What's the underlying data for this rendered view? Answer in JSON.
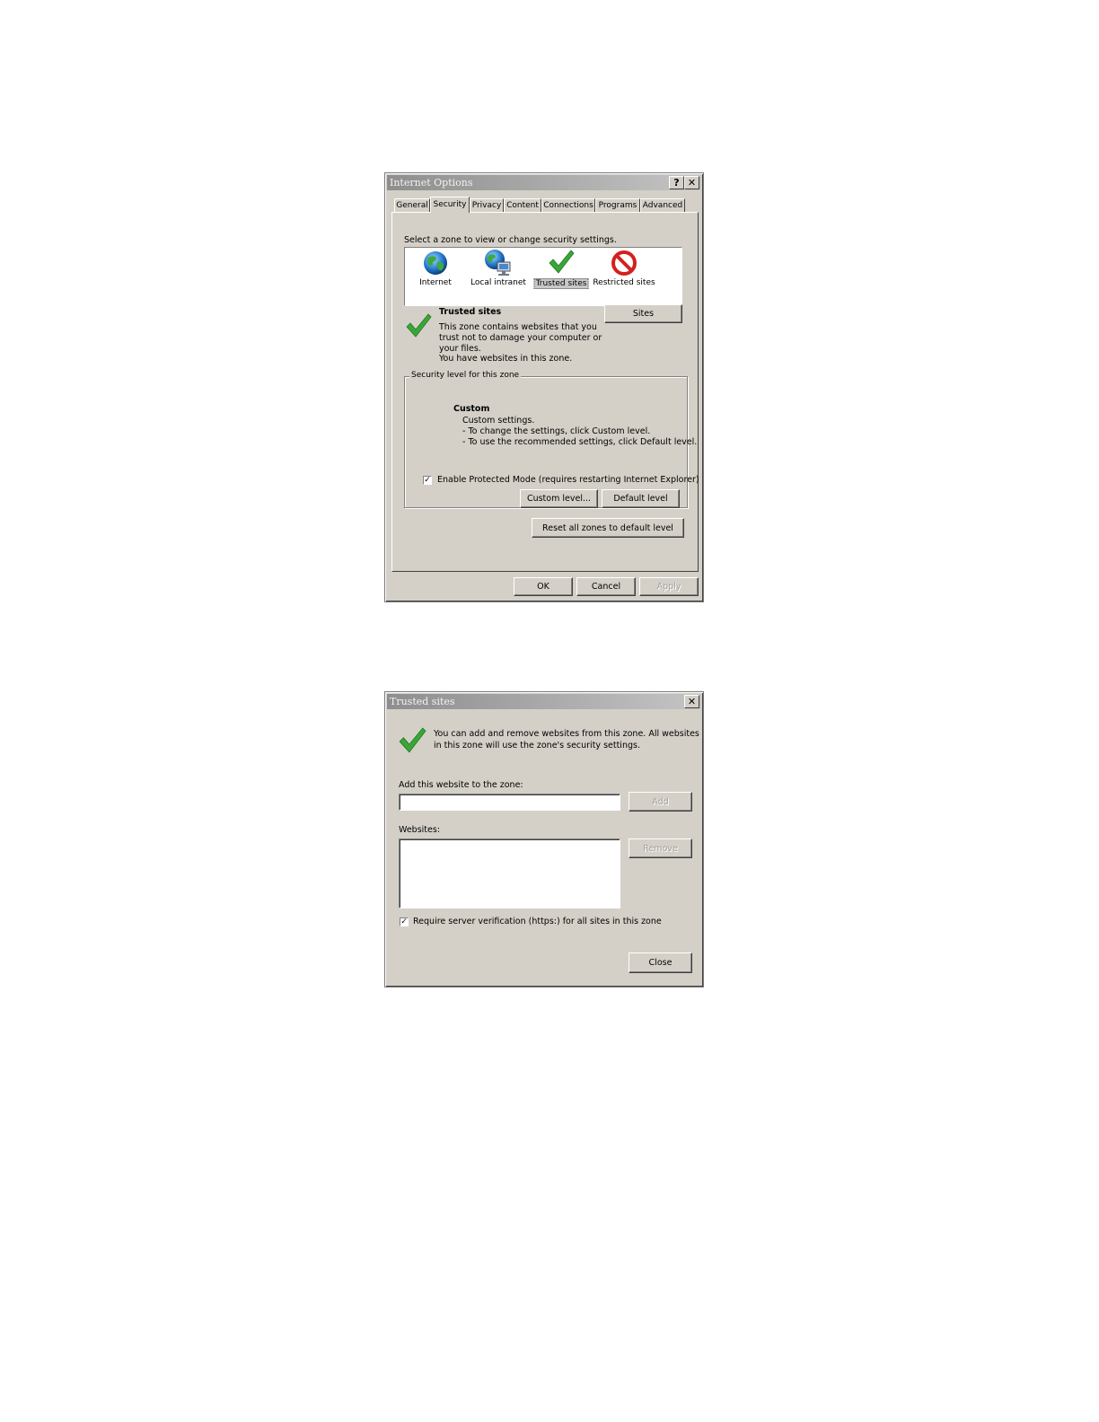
{
  "internet_options": {
    "title": "Internet Options",
    "help_glyph": "?",
    "close_glyph": "✕",
    "tabs": [
      "General",
      "Security",
      "Privacy",
      "Content",
      "Connections",
      "Programs",
      "Advanced"
    ],
    "active_tab": "Security",
    "zone_prompt": "Select a zone to view or change security settings.",
    "zones": [
      {
        "label": "Internet",
        "icon": "globe-icon"
      },
      {
        "label": "Local intranet",
        "icon": "intranet-icon"
      },
      {
        "label": "Trusted sites",
        "icon": "checkmark-icon",
        "selected": true
      },
      {
        "label": "Restricted sites",
        "icon": "prohibited-icon"
      }
    ],
    "zone_heading": "Trusted sites",
    "zone_desc_1": "This zone contains websites that you",
    "zone_desc_2": "trust not to damage your computer or",
    "zone_desc_3": "your files.",
    "zone_desc_4": "You have websites in this zone.",
    "sites_button": "Sites",
    "security_group_title": "Security level for this zone",
    "level_name": "Custom",
    "level_line_1": "Custom settings.",
    "level_line_2": "- To change the settings, click Custom level.",
    "level_line_3": "- To use the recommended settings, click Default level.",
    "protected_mode_checked": true,
    "protected_mode_label": "Enable Protected Mode (requires restarting Internet Explorer)",
    "custom_level_button": "Custom level...",
    "default_level_button": "Default level",
    "reset_button": "Reset all zones to default level",
    "ok_button": "OK",
    "cancel_button": "Cancel",
    "apply_button": "Apply",
    "check_glyph": "✓"
  },
  "trusted_sites": {
    "title": "Trusted sites",
    "close_glyph": "✕",
    "info_text_1": "You can add and remove websites from this zone. All websites",
    "info_text_2": "in this zone will use the zone's security settings.",
    "add_label": "Add this website to the zone:",
    "add_input_value": "",
    "add_button": "Add",
    "websites_label": "Websites:",
    "websites": [],
    "remove_button": "Remove",
    "require_https_checked": true,
    "require_https_label": "Require server verification (https:) for all sites in this zone",
    "close_button": "Close",
    "check_glyph": "✓"
  },
  "colors": {
    "dialog_bg": "#d4d0c8",
    "check_green": "#3aa63a",
    "prohibit_red": "#d42020"
  }
}
